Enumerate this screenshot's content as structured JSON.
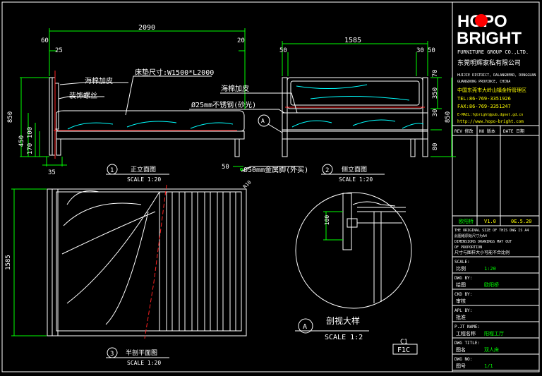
{
  "dims": {
    "total_length": "2090",
    "d60": "60",
    "d25": "25",
    "d20": "20",
    "width": "1585",
    "d50a": "50",
    "d30": "30",
    "d50b": "50",
    "h850": "850",
    "h450": "450",
    "h100": "100",
    "h170": "170",
    "h35": "35",
    "r70": "70",
    "r350": "350",
    "r30": "30",
    "r80": "80",
    "r850": "850",
    "d50c": "50",
    "plan_1585": "1585",
    "plan_r10": "R10",
    "detail_100": "100"
  },
  "labels": {
    "sponge": "海棉加皮",
    "decor": "装饰螺丝",
    "mattress": "床垫尺寸:W1500*L2000",
    "sponge2": "海棉加皮",
    "steel": "Ø25mm不锈钢(砂光)",
    "foot": "Ø50mm金属脚(外买)",
    "marker_a": "A"
  },
  "views": [
    {
      "num": "1",
      "name": "正立面图",
      "scale": "SCALE 1:20"
    },
    {
      "num": "2",
      "name": "侧立面图",
      "scale": "SCALE 1:20"
    },
    {
      "num": "3",
      "name": "半剖平面图",
      "scale": "SCALE 1:20"
    }
  ],
  "detail": {
    "letter": "A",
    "name": "剖视大样",
    "scale": "SCALE 1:2"
  },
  "code": {
    "above": "C1",
    "box": "F1C"
  },
  "titleblock": {
    "logo_top": "HOPO",
    "logo_bottom": "BRIGHT",
    "company_en": "FURNITURE GROUP CO.,LTD.",
    "company_cn": "东莞明辉家私有限公司",
    "addr1": "HUIJIE DISTRICT, DALANGBEND, DONGGUAN",
    "addr2": "GUANGDONG PROVINCE, CHINA",
    "addr3": "中国东莞市大岭山镇金桥管理区",
    "tel": "TEL:86-769-3351926",
    "fax": "FAX:86-769-3351247",
    "email": "E-MAIL:fgbright@pub.dgnet.gd.cn",
    "web": "http://www.hopo-bright.com",
    "rev_head": [
      "REV 修改",
      "NO 版本",
      "DATE 日期"
    ],
    "rev_row": {
      "by": "欧阳桥",
      "ver": "V1.0",
      "date": "0E.5.20"
    },
    "notice": [
      "THE ORIGINAL SIZE OF THIS DWG IS A4",
      "此图纸原始尺寸为A4",
      "DIMENSIONS DRAWINGS MAY OUT",
      "OF PROPORTION",
      "尺寸与图样大小可能不合比例"
    ],
    "rows": [
      {
        "en": "SCALE:",
        "cn": "比例",
        "val": "1:20"
      },
      {
        "en": "DWG BY:",
        "cn": "绘图",
        "val": "欧阳桥"
      },
      {
        "en": "CKD BY:",
        "cn": "审核",
        "val": ""
      },
      {
        "en": "APL BY:",
        "cn": "批准",
        "val": ""
      },
      {
        "en": "P.JT NAME:",
        "cn": "工程名称",
        "val": "阳程工厅"
      },
      {
        "en": "DWG TITLE:",
        "cn": "图名",
        "val": "双人床"
      },
      {
        "en": "DWG NO:",
        "cn": "图号",
        "val": "1/1"
      }
    ]
  }
}
